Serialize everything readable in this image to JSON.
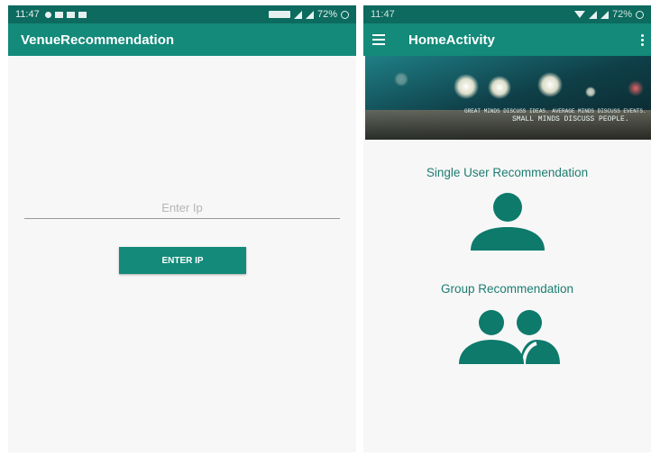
{
  "colors": {
    "status_bar": "#0c6a5e",
    "app_bar": "#138a7a",
    "accent": "#1d7d71",
    "background": "#f7f7f7"
  },
  "left_screen": {
    "status_bar": {
      "time": "11:47",
      "battery": "72%"
    },
    "app_bar": {
      "title": "VenueRecommendation"
    },
    "ip_input": {
      "value": "",
      "placeholder": "Enter Ip"
    },
    "enter_button": {
      "label": "ENTER IP"
    }
  },
  "right_screen": {
    "status_bar": {
      "time": "11:47",
      "battery": "72%"
    },
    "app_bar": {
      "title": "HomeActivity",
      "menu_icon": "hamburger-menu-icon",
      "overflow_icon": "overflow-menu-icon"
    },
    "banner": {
      "line1": "GREAT MINDS DISCUSS IDEAS. AVERAGE MINDS DISCUSS EVENTS.",
      "line2": "SMALL MINDS DISCUSS PEOPLE."
    },
    "single_user": {
      "label": "Single User Recommendation",
      "icon": "person-icon"
    },
    "group": {
      "label": "Group Recommendation",
      "icon": "group-icon"
    }
  }
}
